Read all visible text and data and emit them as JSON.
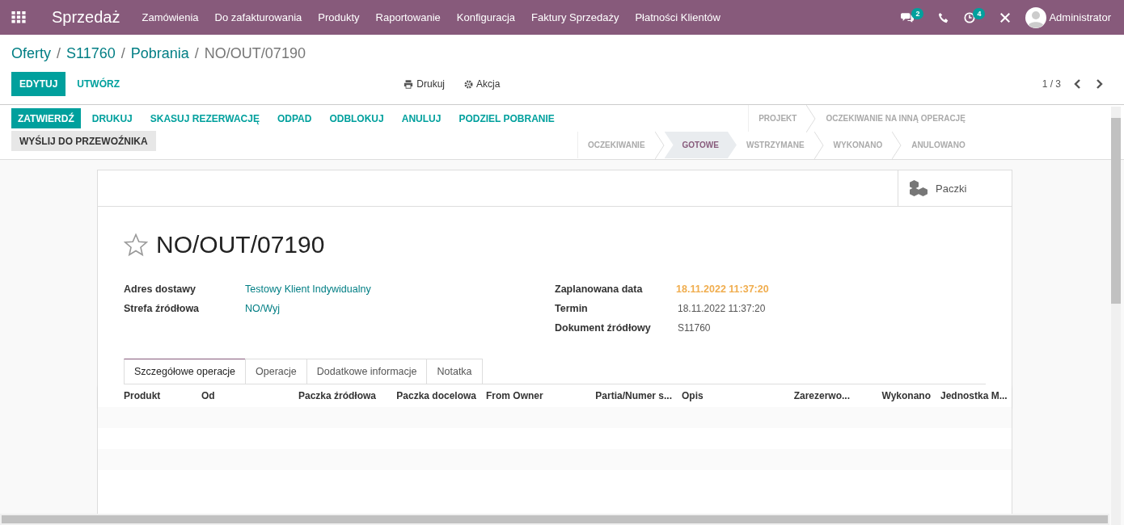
{
  "navbar": {
    "app_name": "Sprzedaż",
    "menu": [
      "Zamówienia",
      "Do zafakturowania",
      "Produkty",
      "Raportowanie",
      "Konfiguracja",
      "Faktury Sprzedaży",
      "Płatności Klientów"
    ],
    "messages_badge": "2",
    "activities_badge": "4",
    "user": "Administrator"
  },
  "breadcrumb": [
    {
      "label": "Oferty",
      "kind": "link"
    },
    {
      "separator": "/",
      "label": "S11760",
      "kind": "link"
    },
    {
      "separator": "/",
      "label": "Pobrania",
      "kind": "link"
    },
    {
      "separator": "/",
      "label": "NO/OUT/07190",
      "kind": "current"
    }
  ],
  "controls": {
    "edit": "EDYTUJ",
    "create": "UTWÓRZ",
    "print": "Drukuj",
    "action": "Akcja",
    "pager": "1 / 3"
  },
  "action_buttons": [
    {
      "label": "ZATWIERDŹ",
      "kind": "primary"
    },
    {
      "label": "DRUKUJ",
      "kind": "link"
    },
    {
      "label": "SKASUJ REZERWACJĘ",
      "kind": "link"
    },
    {
      "label": "ODPAD",
      "kind": "link"
    },
    {
      "label": "ODBLOKUJ",
      "kind": "link"
    },
    {
      "label": "ANULUJ",
      "kind": "link"
    },
    {
      "label": "PODZIEL POBRANIE",
      "kind": "link"
    },
    {
      "label": "WYŚLIJ DO PRZEWOŹNIKA",
      "kind": "secondary"
    }
  ],
  "status_rows": [
    [
      {
        "label": "PROJEKT",
        "selected": false
      },
      {
        "label": "OCZEKIWANIE NA INNĄ OPERACJĘ",
        "selected": false
      }
    ],
    [
      {
        "label": "OCZEKIWANIE",
        "selected": false
      },
      {
        "label": "GOTOWE",
        "selected": true
      },
      {
        "label": "WSTRZYMANE",
        "selected": false
      },
      {
        "label": "WYKONANO",
        "selected": false
      },
      {
        "label": "ANULOWANO",
        "selected": false
      }
    ]
  ],
  "smart_button": "Paczki",
  "record": {
    "title": "NO/OUT/07190",
    "starred": false,
    "left_fields": [
      {
        "label": "Adres dostawy",
        "value": "Testowy Klient Indywidualny",
        "kind": "link"
      },
      {
        "label": "Strefa źródłowa",
        "value": "NO/Wyj",
        "kind": "link"
      }
    ],
    "right_fields": [
      {
        "label": "Zaplanowana data",
        "value": "18.11.2022 11:37:20",
        "kind": "warning"
      },
      {
        "label": "Termin",
        "value": "18.11.2022 11:37:20",
        "kind": "plain"
      },
      {
        "label": "Dokument źródłowy",
        "value": "S11760",
        "kind": "plain"
      }
    ]
  },
  "tabs": [
    {
      "label": "Szczegółowe operacje",
      "selected": true
    },
    {
      "label": "Operacje",
      "selected": false
    },
    {
      "label": "Dodatkowe informacje",
      "selected": false
    },
    {
      "label": "Notatka",
      "selected": false
    }
  ],
  "table": {
    "columns": [
      "Produkt",
      "Od",
      "Paczka źródłowa",
      "Paczka docelowa",
      "From Owner",
      "Partia/Numer s...",
      "Opis",
      "Zarezerwo...",
      "Wykonano",
      "Jednostka M..."
    ]
  }
}
